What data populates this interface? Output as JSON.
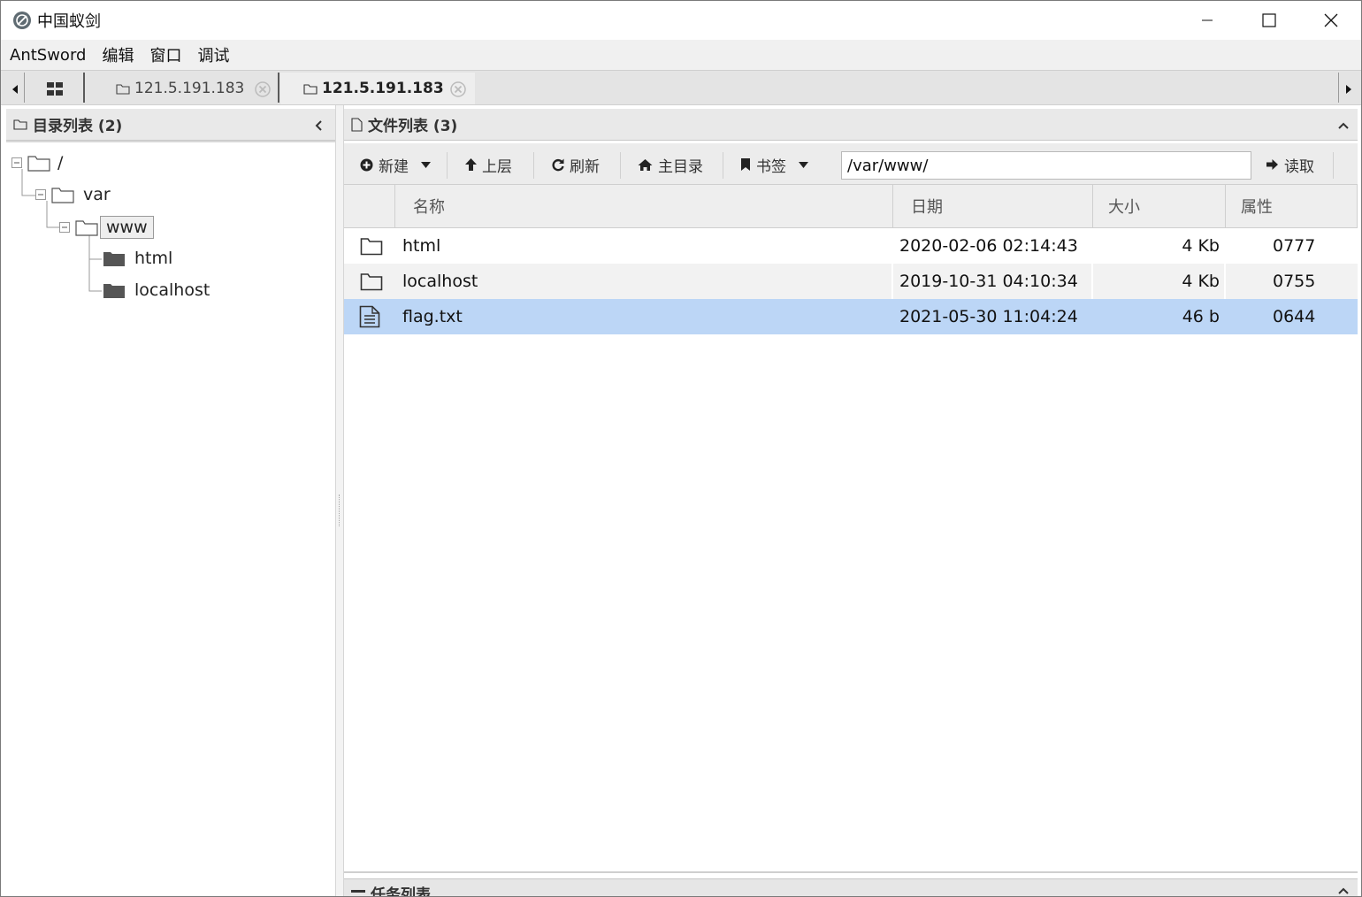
{
  "window": {
    "title": "中国蚁剑"
  },
  "menu": {
    "items": [
      "AntSword",
      "编辑",
      "窗口",
      "调试"
    ]
  },
  "tabs": [
    {
      "label": "121.5.191.183",
      "active": false
    },
    {
      "label": "121.5.191.183",
      "active": true
    }
  ],
  "dir_panel": {
    "title": "目录列表 (2)"
  },
  "tree": {
    "root": "/",
    "var": "var",
    "www": "www",
    "html": "html",
    "localhost": "localhost"
  },
  "file_panel": {
    "title": "文件列表 (3)"
  },
  "toolbar": {
    "new_label": "新建",
    "up_label": "上层",
    "refresh_label": "刷新",
    "home_label": "主目录",
    "bookmark_label": "书签",
    "path_value": "/var/www/",
    "read_label": "读取"
  },
  "grid": {
    "columns": [
      "名称",
      "日期",
      "大小",
      "属性"
    ],
    "rows": [
      {
        "type": "folder",
        "name": "html",
        "date": "2020-02-06 02:14:43",
        "size": "4 Kb",
        "perm": "0777",
        "selected": false
      },
      {
        "type": "folder",
        "name": "localhost",
        "date": "2019-10-31 04:10:34",
        "size": "4 Kb",
        "perm": "0755",
        "selected": false
      },
      {
        "type": "file",
        "name": "flag.txt",
        "date": "2021-05-30 11:04:24",
        "size": "46 b",
        "perm": "0644",
        "selected": true
      }
    ]
  },
  "task_panel": {
    "title": "任务列表"
  },
  "colors": {
    "selected_row": "#bcd6f6",
    "alt_row": "#f2f2f2",
    "header_bg": "#e9e9e9"
  }
}
